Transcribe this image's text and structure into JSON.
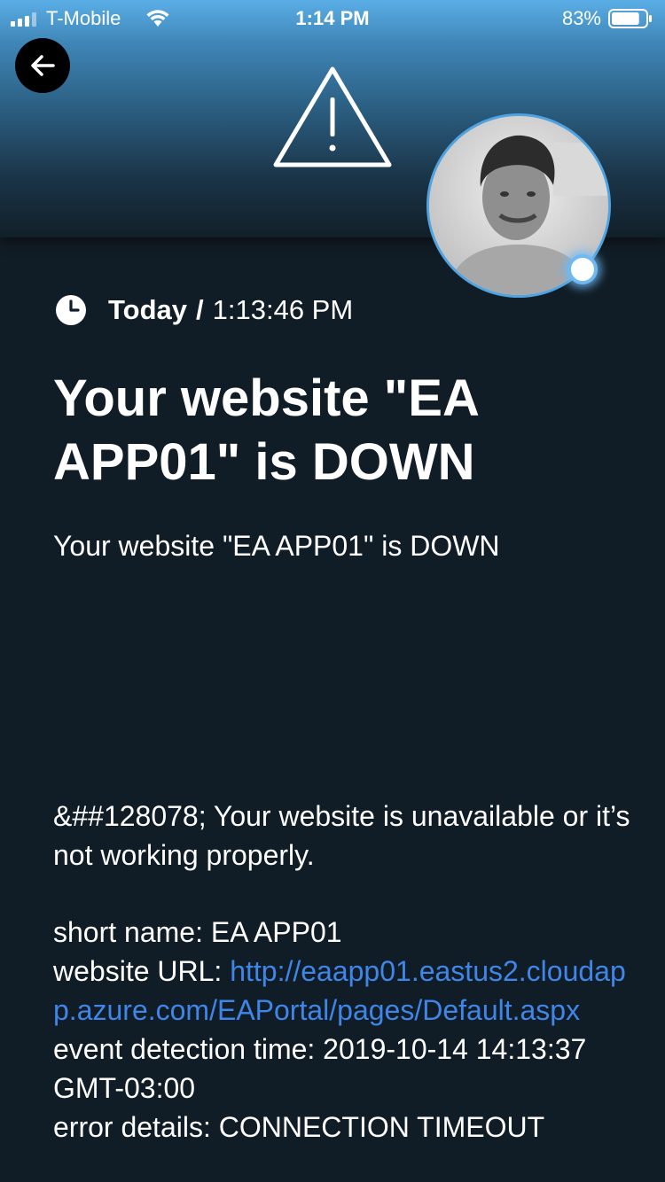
{
  "status_bar": {
    "carrier": "T-Mobile",
    "time": "1:14 PM",
    "battery_percent": "83%",
    "battery_level": 0.83
  },
  "header": {
    "back_icon": "arrow-left-icon",
    "alert_icon": "warning-triangle-icon",
    "status_dot_color": "#6fb9f2"
  },
  "event": {
    "day": "Today",
    "separator": "/",
    "time": "1:13:46 PM",
    "title": "Your website \"EA APP01\" is DOWN",
    "subtitle": "Your website \"EA APP01\" is DOWN",
    "message": "&##128078; Your website is unavailable or it’s not working properly.",
    "short_name_label": "short name: ",
    "short_name": "EA APP01",
    "url_label": "website URL: ",
    "url": "http://eaapp01.eastus2.cloudapp.azure.com/EAPortal/pages/Default.aspx",
    "detection_label": "event detection time: ",
    "detection_time": "2019-10-14 14:13:37 GMT-03:00",
    "error_label": "error details: ",
    "error": "CONNECTION TIMEOUT"
  },
  "colors": {
    "background": "#111d26",
    "link": "#3f86e8",
    "avatar_ring": "#4fa3e0"
  }
}
